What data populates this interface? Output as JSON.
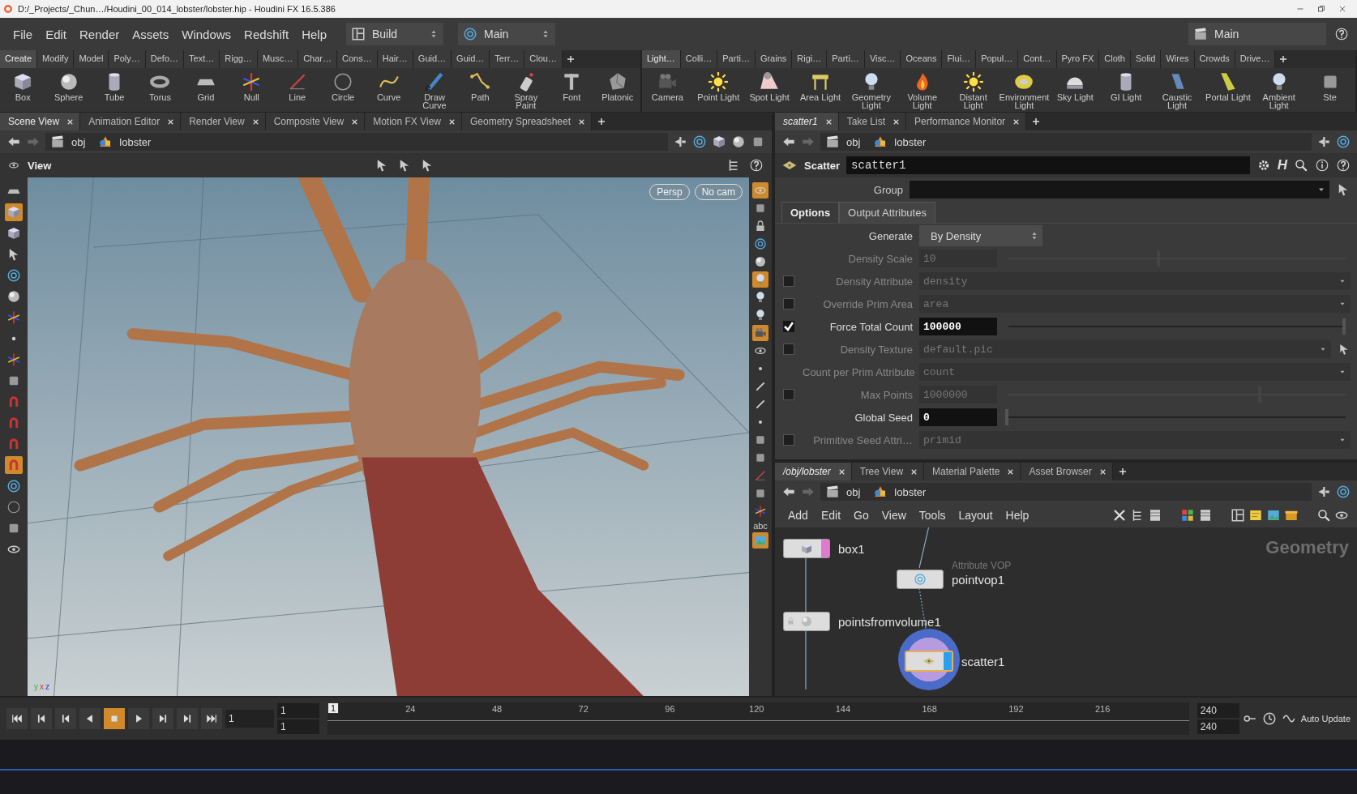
{
  "window": {
    "title": "D:/_Projects/_Chun…/Houdini_00_014_lobster/lobster.hip - Houdini FX 16.5.386"
  },
  "menu": [
    "File",
    "Edit",
    "Render",
    "Assets",
    "Windows",
    "Redshift",
    "Help"
  ],
  "desktops": [
    {
      "label": "Build",
      "kind": "layout"
    },
    {
      "label": "Main",
      "kind": "target"
    }
  ],
  "right_desktop": {
    "label": "Main"
  },
  "shelves": [
    {
      "tabs": [
        {
          "label": "Create",
          "selected": true
        },
        {
          "label": "Modify",
          "selected": false
        },
        {
          "label": "Model",
          "selected": false
        },
        {
          "label": "Poly…",
          "selected": false
        },
        {
          "label": "Defo…",
          "selected": false
        },
        {
          "label": "Text…",
          "selected": false
        },
        {
          "label": "Rigg…",
          "selected": false
        },
        {
          "label": "Musc…",
          "selected": false
        },
        {
          "label": "Char…",
          "selected": false
        },
        {
          "label": "Cons…",
          "selected": false
        },
        {
          "label": "Hair…",
          "selected": false
        },
        {
          "label": "Guid…",
          "selected": false
        },
        {
          "label": "Guid…",
          "selected": false
        },
        {
          "label": "Terr…",
          "selected": false
        },
        {
          "label": "Clou…",
          "selected": false
        }
      ],
      "tools": [
        "Box",
        "Sphere",
        "Tube",
        "Torus",
        "Grid",
        "Null",
        "Line",
        "Circle",
        "Curve",
        "Draw Curve",
        "Path",
        "Spray Paint",
        "Font",
        "Platonic"
      ]
    },
    {
      "tabs": [
        {
          "label": "Light…",
          "selected": true
        },
        {
          "label": "Colli…",
          "selected": false
        },
        {
          "label": "Parti…",
          "selected": false
        },
        {
          "label": "Grains",
          "selected": false
        },
        {
          "label": "Rigi…",
          "selected": false
        },
        {
          "label": "Parti…",
          "selected": false
        },
        {
          "label": "Visc…",
          "selected": false
        },
        {
          "label": "Oceans",
          "selected": false
        },
        {
          "label": "Flui…",
          "selected": false
        },
        {
          "label": "Popul…",
          "selected": false
        },
        {
          "label": "Cont…",
          "selected": false
        },
        {
          "label": "Pyro FX",
          "selected": false
        },
        {
          "label": "Cloth",
          "selected": false
        },
        {
          "label": "Solid",
          "selected": false
        },
        {
          "label": "Wires",
          "selected": false
        },
        {
          "label": "Crowds",
          "selected": false
        },
        {
          "label": "Drive…",
          "selected": false
        }
      ],
      "tools": [
        "Camera",
        "Point Light",
        "Spot Light",
        "Area Light",
        "Geometry Light",
        "Volume Light",
        "Distant Light",
        "Environment Light",
        "Sky Light",
        "GI Light",
        "Caustic Light",
        "Portal Light",
        "Ambient Light",
        "Ste"
      ]
    }
  ],
  "scene_pane": {
    "tabs": [
      {
        "label": "Scene View",
        "selected": true
      },
      {
        "label": "Animation Editor",
        "selected": false
      },
      {
        "label": "Render View",
        "selected": false
      },
      {
        "label": "Composite View",
        "selected": false
      },
      {
        "label": "Motion FX View",
        "selected": false
      },
      {
        "label": "Geometry Spreadsheet",
        "selected": false
      }
    ],
    "path": [
      "obj",
      "lobster"
    ],
    "view_label": "View",
    "camera_menus": [
      "Persp",
      "No cam"
    ],
    "axis_labels": [
      "y",
      "x",
      "z"
    ],
    "side_label": "abc",
    "left_tools": [
      {
        "active": false
      },
      {
        "active": true
      },
      {
        "active": false
      },
      {
        "active": false
      },
      {
        "active": false
      },
      {
        "active": false
      },
      {
        "active": false
      },
      {
        "active": false
      },
      {
        "active": false
      },
      {
        "active": false
      },
      {
        "active": false
      },
      {
        "active": false
      },
      {
        "active": false
      },
      {
        "active": true
      },
      {
        "active": false
      },
      {
        "active": false
      },
      {
        "active": false
      },
      {
        "active": false
      }
    ],
    "right_tools": [
      {
        "active": true
      },
      {
        "active": false
      },
      {
        "active": false
      },
      {
        "active": false
      },
      {
        "active": false
      },
      {
        "active": true
      },
      {
        "active": false
      },
      {
        "active": false
      },
      {
        "active": true
      },
      {
        "active": false
      },
      {
        "active": false
      },
      {
        "active": false
      },
      {
        "active": false
      },
      {
        "active": false
      },
      {
        "active": false
      },
      {
        "active": false
      },
      {
        "active": false
      },
      {
        "active": false
      },
      {
        "active": false
      },
      {
        "active": true
      }
    ]
  },
  "params_pane": {
    "tabs": [
      {
        "label": "scatter1",
        "selected": true
      },
      {
        "label": "Take List",
        "selected": false
      },
      {
        "label": "Performance Monitor",
        "selected": false
      }
    ],
    "path": [
      "obj",
      "lobster"
    ],
    "node_type": "Scatter",
    "node_name": "scatter1",
    "help_glyph": "H",
    "group_label": "Group",
    "param_tabs": [
      {
        "label": "Options",
        "selected": true
      },
      {
        "label": "Output Attributes",
        "selected": false
      }
    ],
    "params": [
      {
        "kind": "menu",
        "label": "Generate",
        "value": "By Density",
        "disabled": false
      },
      {
        "kind": "slider",
        "label": "Density Scale",
        "value": "10",
        "disabled": true,
        "level": 0.45
      },
      {
        "kind": "string",
        "label": "Density Attribute",
        "value": "density",
        "disabled": true,
        "checked": false
      },
      {
        "kind": "string",
        "label": "Override Prim Area",
        "value": "area",
        "disabled": true,
        "checked": false
      },
      {
        "kind": "slider",
        "label": "Force Total Count",
        "value": "100000",
        "disabled": false,
        "checked": true,
        "level": 1
      },
      {
        "kind": "file",
        "label": "Density Texture",
        "value": "default.pic",
        "disabled": true,
        "checked": false
      },
      {
        "kind": "string",
        "label": "Count per Prim Attribute",
        "value": "count",
        "disabled": true
      },
      {
        "kind": "slider",
        "label": "Max Points",
        "value": "1000000",
        "disabled": true,
        "checked": false,
        "level": 0.75
      },
      {
        "kind": "slider",
        "label": "Global Seed",
        "value": "0",
        "disabled": false,
        "level": 0
      },
      {
        "kind": "string",
        "label": "Primitive Seed Attri…",
        "value": "primid",
        "disabled": true,
        "checked": false
      }
    ]
  },
  "network_pane": {
    "tabs": [
      {
        "label": "/obj/lobster",
        "selected": true
      },
      {
        "label": "Tree View",
        "selected": false
      },
      {
        "label": "Material Palette",
        "selected": false
      },
      {
        "label": "Asset Browser",
        "selected": false
      }
    ],
    "path": [
      "obj",
      "lobster"
    ],
    "menu": [
      "Add",
      "Edit",
      "Go",
      "View",
      "Tools",
      "Layout",
      "Help"
    ],
    "context_label": "Geometry",
    "nodes": [
      {
        "name": "box1",
        "template_flag": true,
        "display_flag": false,
        "selected": false,
        "locked": false
      },
      {
        "name": "pointvop1",
        "subtitle": "Attribute VOP",
        "template_flag": false,
        "display_flag": false,
        "selected": false,
        "locked": false
      },
      {
        "name": "pointsfromvolume1",
        "template_flag": false,
        "display_flag": false,
        "selected": false,
        "locked": true
      },
      {
        "name": "scatter1",
        "template_flag": false,
        "display_flag": true,
        "selected": true,
        "locked": false
      }
    ]
  },
  "timeline": {
    "frame_field": "1",
    "start_fields": [
      "1",
      "1"
    ],
    "current_marker": "1",
    "tick_labels": [
      "24",
      "48",
      "72",
      "96",
      "120",
      "144",
      "168",
      "192",
      "216"
    ],
    "end_fields": [
      "240",
      "240"
    ],
    "auto_update": "Auto Update"
  }
}
